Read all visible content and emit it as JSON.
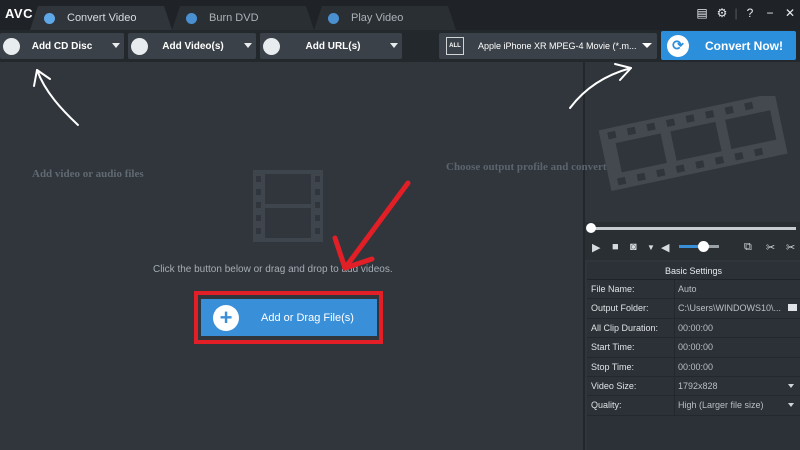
{
  "app": {
    "logo": "AVC"
  },
  "tabs": [
    {
      "label": "Convert Video",
      "active": true
    },
    {
      "label": "Burn DVD",
      "active": false
    },
    {
      "label": "Play Video",
      "active": false
    }
  ],
  "window_controls": {
    "menu_icon": "menu-icon",
    "settings_icon": "gear-icon",
    "help": "?",
    "minimize": "−",
    "close": "✕"
  },
  "toolbar": {
    "add_cd": "Add CD Disc",
    "add_videos": "Add Video(s)",
    "add_url": "Add URL(s)",
    "profile": "Apple iPhone XR MPEG-4 Movie (*.m...",
    "convert": "Convert Now!"
  },
  "workspace": {
    "left_hint": "Add video or audio files",
    "right_hint": "Choose output profile and convert",
    "drop_hint": "Click the button below or drag and drop to add videos.",
    "add_button": "Add or Drag File(s)"
  },
  "player": {
    "volume_level": 0.6
  },
  "settings": {
    "title": "Basic Settings",
    "rows": [
      {
        "key": "File Name:",
        "value": "Auto"
      },
      {
        "key": "Output Folder:",
        "value": "C:\\Users\\WINDOWS10\\..."
      },
      {
        "key": "All Clip Duration:",
        "value": "00:00:00"
      },
      {
        "key": "Start Time:",
        "value": "00:00:00"
      },
      {
        "key": "Stop Time:",
        "value": "00:00:00"
      },
      {
        "key": "Video Size:",
        "value": "1792x828"
      },
      {
        "key": "Quality:",
        "value": "High (Larger file size)"
      }
    ]
  },
  "colors": {
    "accent": "#2c8fdc",
    "highlight": "#e21f26",
    "background": "#30363c"
  }
}
